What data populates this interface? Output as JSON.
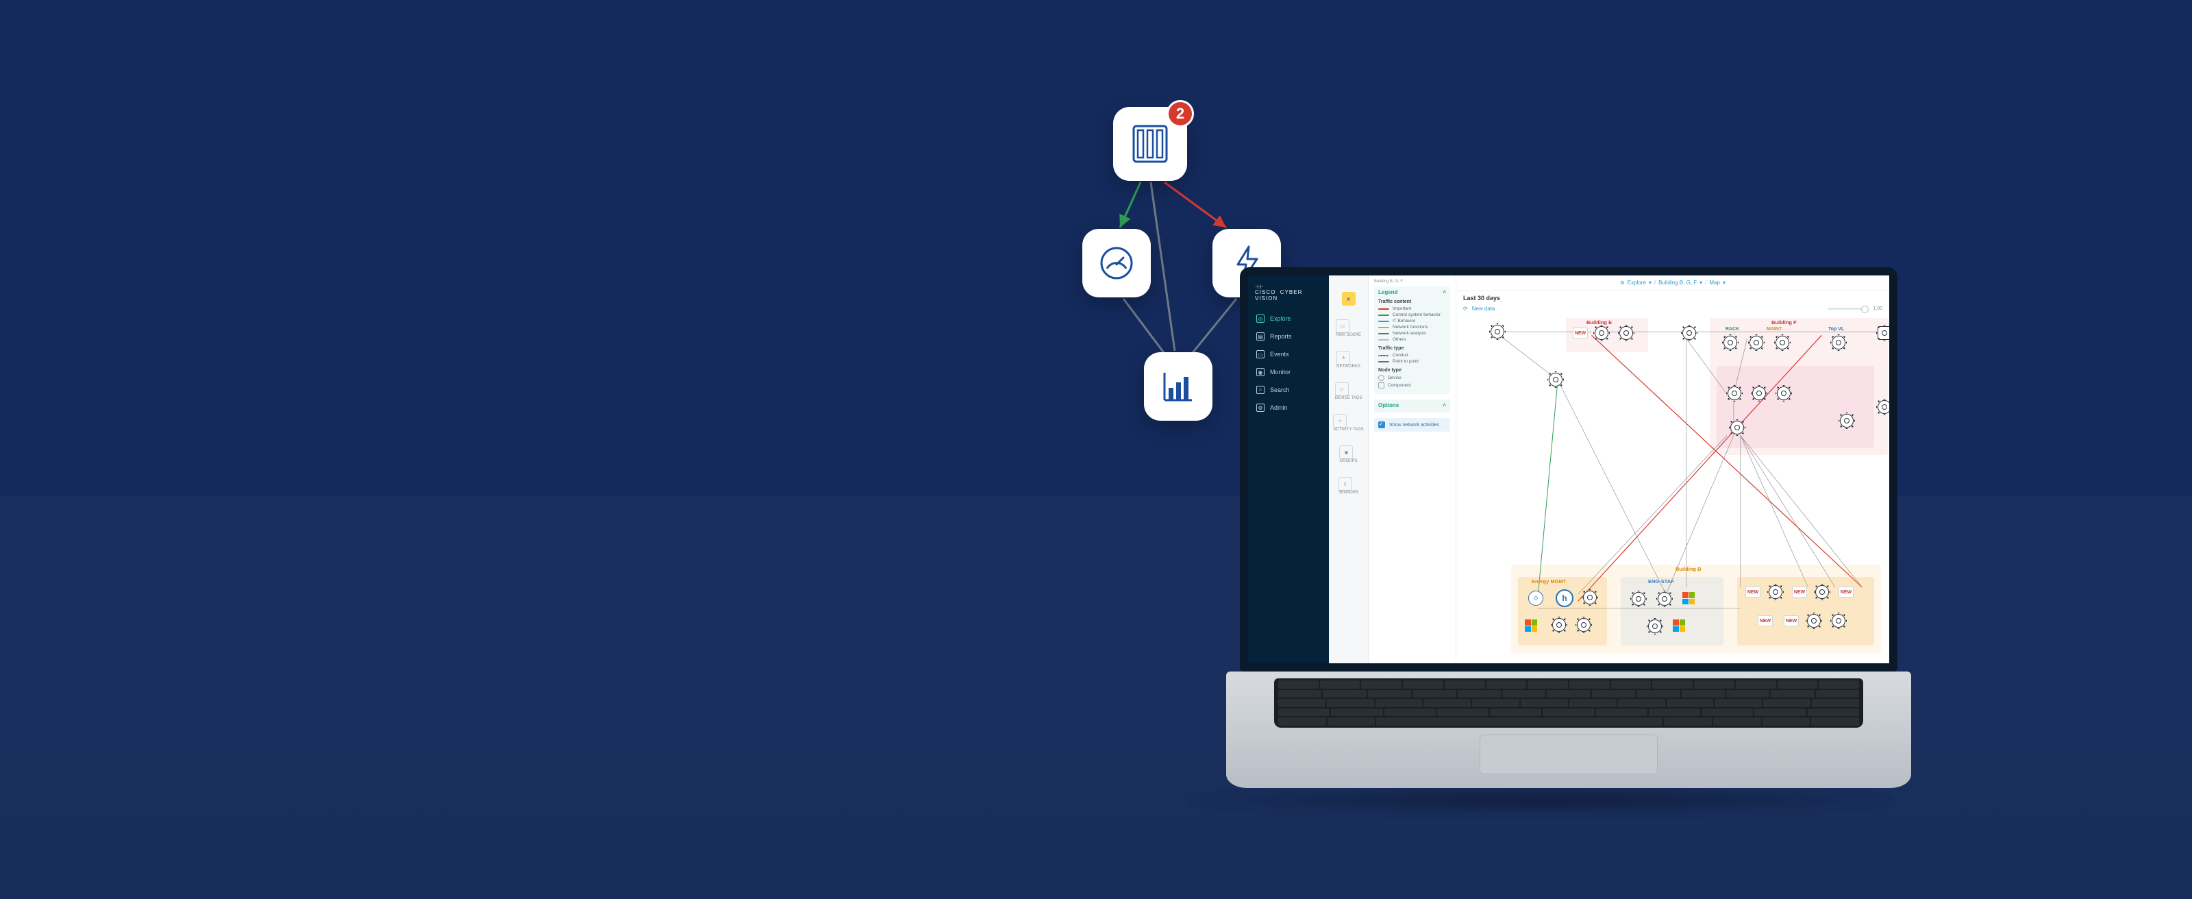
{
  "popout": {
    "badge": "2"
  },
  "app": {
    "brand_line1": "· · | · · | · ·",
    "brand_line2": "CISCO",
    "brand_product": "CYBER VISION",
    "nav": [
      {
        "label": "Explore",
        "active": true
      },
      {
        "label": "Reports"
      },
      {
        "label": "Events"
      },
      {
        "label": "Monitor"
      },
      {
        "label": "Search"
      },
      {
        "label": "Admin"
      }
    ],
    "rail": [
      {
        "label": ""
      },
      {
        "label": "RISK SCORE"
      },
      {
        "label": "NETWORKS"
      },
      {
        "label": "DEVICE TAGS"
      },
      {
        "label": "ACTIVITY TAGS"
      },
      {
        "label": "GROUPS"
      },
      {
        "label": "SENSORS"
      }
    ],
    "breadcrumb_mini": "Building B, G, F",
    "legend": {
      "title": "Legend",
      "traffic_content_h": "Traffic content",
      "items_content": [
        {
          "label": "Important",
          "color": "#d63a2f"
        },
        {
          "label": "Control system behavior",
          "color": "#2e9d55"
        },
        {
          "label": "IT Behavior",
          "color": "#2fa0c9"
        },
        {
          "label": "Network functions",
          "color": "#e0a51a"
        },
        {
          "label": "Network analysis",
          "color": "#6b6f75"
        },
        {
          "label": "Others",
          "color": "#b7bcc2"
        }
      ],
      "traffic_type_h": "Traffic type",
      "items_type": [
        {
          "label": "Conduit",
          "style": "dotted"
        },
        {
          "label": "Point to point",
          "style": "solid"
        }
      ],
      "node_type_h": "Node type",
      "items_node": [
        {
          "label": "Device"
        },
        {
          "label": "Component"
        }
      ],
      "options_title": "Options",
      "checkbox_label": "Show network activities"
    },
    "topbar": {
      "explore": "Explore",
      "crumb": "Building B, G, F",
      "view": "Map"
    },
    "title": "Last 30 days",
    "newdata": {
      "label": "New data",
      "slider_val": "1.00"
    },
    "groups": {
      "buildingE": "Building E",
      "buildingF": "Building F",
      "buildingB": "Building B",
      "energy": "Energy MGMT",
      "engstaf": "ENG-STAF",
      "rack": "RACK",
      "maint": "MAINT",
      "topvl": "Top VL",
      "chip_new": "NEW"
    }
  }
}
